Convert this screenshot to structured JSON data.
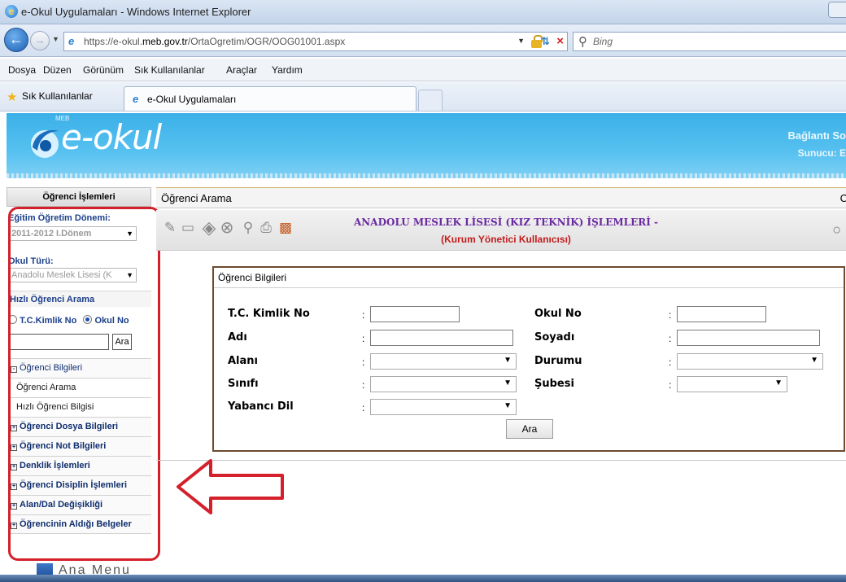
{
  "window": {
    "title": "e-Okul Uygulamaları - Windows Internet Explorer"
  },
  "address_bar": {
    "url_prefix": "https://e-okul.",
    "url_domain": "meb.gov.tr",
    "url_path": "/OrtaOgretim/OGR/OOG01001.aspx",
    "search_placeholder": "Bing"
  },
  "menu": {
    "items": [
      "Dosya",
      "Düzen",
      "Görünüm",
      "Sık Kullanılanlar",
      "Araçlar",
      "Yardım"
    ]
  },
  "favorites": {
    "label": "Sık Kullanılanlar",
    "tab_label": "e-Okul Uygulamaları"
  },
  "page_header": {
    "logo_small": "MEB",
    "logo_text": "e-okul",
    "connection_text": "Bağlantı So",
    "server_text": "Sunucu: E"
  },
  "sidebar": {
    "header": "Öğrenci İşlemleri",
    "term_label": "Eğitim Öğretim Dönemi:",
    "term_value": "2011-2012 I.Dönem",
    "school_type_label": "Okul Türü:",
    "school_type_value": "Anadolu Meslek Lisesi (K",
    "quick_search_label": "Hızlı Öğrenci Arama",
    "radio_tc": "T.C.Kimlik No",
    "radio_okul": "Okul No",
    "search_button": "Ara",
    "menu_items": [
      {
        "label": "Öğrenci Bilgileri",
        "type": "group-open"
      },
      {
        "label": "Öğrenci Arama",
        "type": "sub"
      },
      {
        "label": "Hızlı Öğrenci Bilgisi",
        "type": "sub"
      },
      {
        "label": "Öğrenci Dosya Bilgileri",
        "type": "group"
      },
      {
        "label": "Öğrenci Not Bilgileri",
        "type": "group"
      },
      {
        "label": "Denklik İşlemleri",
        "type": "group"
      },
      {
        "label": "Öğrenci Disiplin İşlemleri",
        "type": "group"
      },
      {
        "label": "Alan/Dal Değişikliği",
        "type": "group"
      },
      {
        "label": "Öğrencinin Aldığı Belgeler",
        "type": "group"
      }
    ],
    "ana_menu": "Ana Menu"
  },
  "content": {
    "title": "Öğrenci Arama",
    "right_letter": "C",
    "school_title": "ANADOLU MESLEK LİSESİ (KIZ TEKNİK) İŞLEMLERİ -",
    "user_role": "(Kurum Yönetici Kullanıcısı)",
    "form": {
      "legend": "Öğrenci Bilgileri",
      "tc_label": "T.C. Kimlik No",
      "okul_no_label": "Okul No",
      "adi_label": "Adı",
      "soyadi_label": "Soyadı",
      "alani_label": "Alanı",
      "durumu_label": "Durumu",
      "sinifi_label": "Sınıfı",
      "subesi_label": "Şubesi",
      "yabanci_dil_label": "Yabancı Dil",
      "colon": ":",
      "search_button": "Ara"
    }
  },
  "colors": {
    "header_blue": "#3bb0e8",
    "annotation_red": "#d4202a",
    "school_title_purple": "#6a2aa0",
    "role_red": "#c41b1b"
  }
}
